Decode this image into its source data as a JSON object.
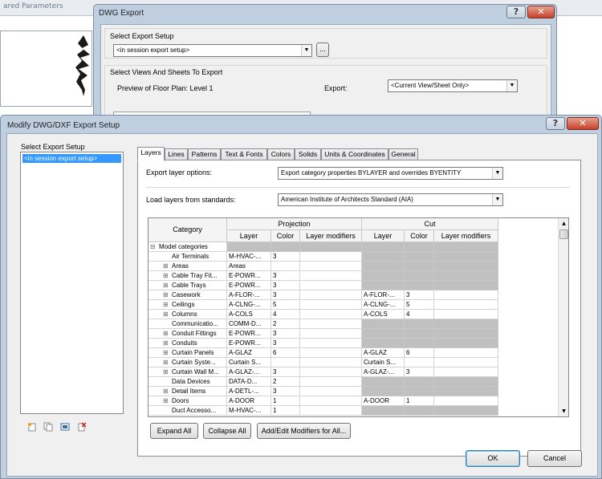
{
  "background": {
    "tab1": "ared",
    "tab2": "Parameters"
  },
  "dwg_export": {
    "title": "DWG Export",
    "help_btn": "?",
    "close_btn": "✕",
    "select_export_setup_label": "Select Export Setup",
    "setup_value": "<in session export setup>",
    "browse_btn": "...",
    "views_group_label": "Select Views And Sheets To Export",
    "preview_label": "Preview of Floor Plan: Level 1",
    "export_label": "Export:",
    "export_value": "<Current View/Sheet Only>"
  },
  "modify": {
    "title": "Modify DWG/DXF Export Setup",
    "help_btn": "?",
    "close_btn": "✕",
    "select_export_setup_label": "Select Export Setup",
    "setups": [
      "<in session export setup>"
    ],
    "tabs": [
      "Layers",
      "Lines",
      "Patterns",
      "Text & Fonts",
      "Colors",
      "Solids",
      "Units & Coordinates",
      "General"
    ],
    "export_layer_options_label": "Export layer options:",
    "export_layer_options_value": "Export category properties BYLAYER and overrides BYENTITY",
    "load_layers_label": "Load layers from standards:",
    "load_layers_value": "American Institute of Architects Standard (AIA)",
    "grid": {
      "headers": {
        "category": "Category",
        "projection": "Projection",
        "cut": "Cut",
        "layer": "Layer",
        "color": "Color",
        "layer_modifiers": "Layer modifiers"
      },
      "rows": [
        {
          "expander": "⊟",
          "name": "Model categories",
          "p_layer": "",
          "p_color": "",
          "c_layer": "",
          "c_color": "",
          "level": 0,
          "p_gray": true,
          "c_gray": true
        },
        {
          "expander": "",
          "name": "Air Terminals",
          "p_layer": "M-HVAC-...",
          "p_color": "3",
          "c_layer": "",
          "c_color": "",
          "level": 1,
          "p_gray": false,
          "c_gray": true
        },
        {
          "expander": "⊞",
          "name": "Areas",
          "p_layer": "Areas",
          "p_color": "",
          "c_layer": "",
          "c_color": "",
          "level": 1,
          "p_gray": false,
          "c_gray": true
        },
        {
          "expander": "⊞",
          "name": "Cable Tray Fit...",
          "p_layer": "E-POWR...",
          "p_color": "3",
          "c_layer": "",
          "c_color": "",
          "level": 1,
          "p_gray": false,
          "c_gray": true
        },
        {
          "expander": "⊞",
          "name": "Cable Trays",
          "p_layer": "E-POWR...",
          "p_color": "3",
          "c_layer": "",
          "c_color": "",
          "level": 1,
          "p_gray": false,
          "c_gray": true
        },
        {
          "expander": "⊞",
          "name": "Casework",
          "p_layer": "A-FLOR-...",
          "p_color": "3",
          "c_layer": "A-FLOR-...",
          "c_color": "3",
          "level": 1,
          "p_gray": false,
          "c_gray": false
        },
        {
          "expander": "⊞",
          "name": "Ceilings",
          "p_layer": "A-CLNG-...",
          "p_color": "5",
          "c_layer": "A-CLNG-...",
          "c_color": "5",
          "level": 1,
          "p_gray": false,
          "c_gray": false
        },
        {
          "expander": "⊞",
          "name": "Columns",
          "p_layer": "A-COLS",
          "p_color": "4",
          "c_layer": "A-COLS",
          "c_color": "4",
          "level": 1,
          "p_gray": false,
          "c_gray": false
        },
        {
          "expander": "",
          "name": "Communicatio...",
          "p_layer": "COMM-D...",
          "p_color": "2",
          "c_layer": "",
          "c_color": "",
          "level": 1,
          "p_gray": false,
          "c_gray": true
        },
        {
          "expander": "⊞",
          "name": "Conduit Fittings",
          "p_layer": "E-POWR...",
          "p_color": "3",
          "c_layer": "",
          "c_color": "",
          "level": 1,
          "p_gray": false,
          "c_gray": true
        },
        {
          "expander": "⊞",
          "name": "Conduits",
          "p_layer": "E-POWR...",
          "p_color": "3",
          "c_layer": "",
          "c_color": "",
          "level": 1,
          "p_gray": false,
          "c_gray": true
        },
        {
          "expander": "⊞",
          "name": "Curtain Panels",
          "p_layer": "A-GLAZ",
          "p_color": "6",
          "c_layer": "A-GLAZ",
          "c_color": "6",
          "level": 1,
          "p_gray": false,
          "c_gray": false
        },
        {
          "expander": "⊞",
          "name": "Curtain Syste...",
          "p_layer": "Curtain S...",
          "p_color": "",
          "c_layer": "Curtain S...",
          "c_color": "",
          "level": 1,
          "p_gray": false,
          "c_gray": false
        },
        {
          "expander": "⊞",
          "name": "Curtain Wall M...",
          "p_layer": "A-GLAZ-...",
          "p_color": "3",
          "c_layer": "A-GLAZ-...",
          "c_color": "3",
          "level": 1,
          "p_gray": false,
          "c_gray": false
        },
        {
          "expander": "",
          "name": "Data Devices",
          "p_layer": "DATA-D...",
          "p_color": "2",
          "c_layer": "",
          "c_color": "",
          "level": 1,
          "p_gray": false,
          "c_gray": true
        },
        {
          "expander": "⊞",
          "name": "Detail Items",
          "p_layer": "A-DETL-...",
          "p_color": "3",
          "c_layer": "",
          "c_color": "",
          "level": 1,
          "p_gray": false,
          "c_gray": true
        },
        {
          "expander": "⊞",
          "name": "Doors",
          "p_layer": "A-DOOR",
          "p_color": "1",
          "c_layer": "A-DOOR",
          "c_color": "1",
          "level": 1,
          "p_gray": false,
          "c_gray": false
        },
        {
          "expander": "",
          "name": "Duct Accesso...",
          "p_layer": "M-HVAC-...",
          "p_color": "1",
          "c_layer": "",
          "c_color": "",
          "level": 1,
          "p_gray": false,
          "c_gray": true
        }
      ]
    },
    "expand_all_btn": "Expand All",
    "collapse_all_btn": "Collapse All",
    "add_edit_btn": "Add/Edit Modifiers for All...",
    "ok_btn": "OK",
    "cancel_btn": "Cancel",
    "toolbar_icons": [
      "new-setup-icon",
      "duplicate-setup-icon",
      "rename-setup-icon",
      "delete-setup-icon"
    ]
  }
}
